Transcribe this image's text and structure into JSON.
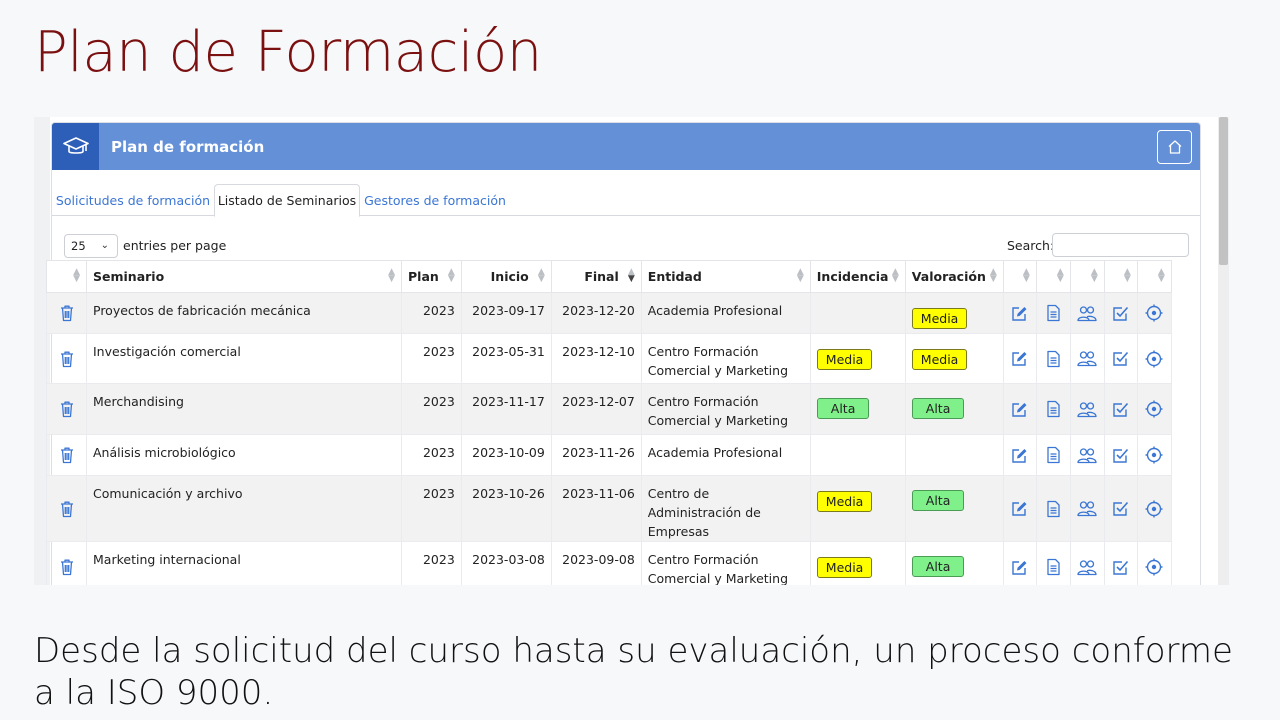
{
  "slide": {
    "title": "Plan de Formación",
    "caption": "Desde la solicitud del curso hasta su evaluación, un proceso conforme a la ISO 9000."
  },
  "card": {
    "title": "Plan de formación",
    "header_color": "#6490d8",
    "accent_color": "#2e5fb8",
    "icon": "graduation-cap-icon",
    "home_icon": "home-icon"
  },
  "tabs": [
    {
      "label": "Solicitudes de formación",
      "active": false
    },
    {
      "label": "Listado de Seminarios",
      "active": true
    },
    {
      "label": "Gestores de formación",
      "active": false
    }
  ],
  "controls": {
    "page_size": "25",
    "entries_label": "entries per page",
    "search_label": "Search:",
    "search_value": ""
  },
  "table": {
    "columns": [
      "Seminario",
      "Plan",
      "Inicio",
      "Final",
      "Entidad",
      "Incidencia",
      "Valoración"
    ],
    "sorted_column": "Final",
    "row_icons": [
      "trash-icon",
      "edit-icon",
      "document-icon",
      "users-icon",
      "checkbox-icon",
      "target-icon"
    ],
    "rows": [
      {
        "seminario": "Proyectos de fabricación mecánica",
        "plan": "2023",
        "inicio": "2023-09-17",
        "final": "2023-12-20",
        "entidad": "Academia Profesional",
        "incidencia": "",
        "valoracion": "Media"
      },
      {
        "seminario": "Investigación comercial",
        "plan": "2023",
        "inicio": "2023-05-31",
        "final": "2023-12-10",
        "entidad": "Centro Formación Comercial y Marketing",
        "incidencia": "Media",
        "valoracion": "Media"
      },
      {
        "seminario": "Merchandising",
        "plan": "2023",
        "inicio": "2023-11-17",
        "final": "2023-12-07",
        "entidad": "Centro Formación Comercial y Marketing",
        "incidencia": "Alta",
        "valoracion": "Alta"
      },
      {
        "seminario": "Análisis microbiológico",
        "plan": "2023",
        "inicio": "2023-10-09",
        "final": "2023-11-26",
        "entidad": "Academia Profesional",
        "incidencia": "",
        "valoracion": ""
      },
      {
        "seminario": "Comunicación y archivo",
        "plan": "2023",
        "inicio": "2023-10-26",
        "final": "2023-11-06",
        "entidad": "Centro de Administración de Empresas",
        "incidencia": "Media",
        "valoracion": "Alta"
      },
      {
        "seminario": "Marketing internacional",
        "plan": "2023",
        "inicio": "2023-03-08",
        "final": "2023-09-08",
        "entidad": "Centro Formación Comercial y Marketing",
        "incidencia": "Media",
        "valoracion": "Alta"
      }
    ]
  },
  "badge_colors": {
    "Media": "#ffff00",
    "Alta": "#7ff08a"
  }
}
